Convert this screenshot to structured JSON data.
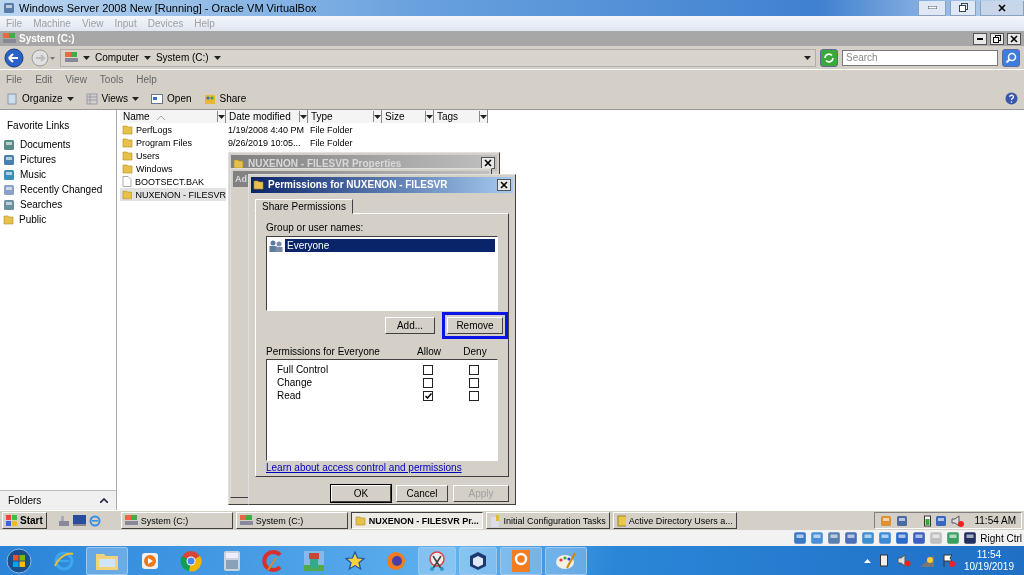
{
  "host_window": {
    "title": "Windows Server 2008 New [Running] - Oracle VM VirtualBox",
    "menu": [
      "File",
      "Machine",
      "View",
      "Input",
      "Devices",
      "Help"
    ]
  },
  "explorer": {
    "title": "System (C:)",
    "breadcrumb": [
      "Computer",
      "System (C:)"
    ],
    "search": {
      "placeholder": "Search"
    },
    "menu": [
      "File",
      "Edit",
      "View",
      "Tools",
      "Help"
    ],
    "toolbar": [
      {
        "label": "Organize",
        "kind": "dropdown"
      },
      {
        "label": "Views",
        "kind": "dropdown"
      },
      {
        "label": "Open",
        "kind": "open"
      },
      {
        "label": "Share",
        "kind": "share"
      }
    ],
    "sidebar": {
      "heading": "Favorite Links",
      "items": [
        {
          "label": "Documents"
        },
        {
          "label": "Pictures"
        },
        {
          "label": "Music"
        },
        {
          "label": "Recently Changed"
        },
        {
          "label": "Searches"
        },
        {
          "label": "Public",
          "kind": "folder"
        }
      ],
      "folders": "Folders"
    },
    "columns": [
      "Name",
      "Date modified",
      "Type",
      "Size",
      "Tags"
    ],
    "rows": [
      {
        "name": "PerfLogs",
        "date": "1/19/2008 4:40 PM",
        "type": "File Folder",
        "kind": "folder",
        "selected": false
      },
      {
        "name": "Program Files",
        "date": "9/26/2019 10:05...",
        "type": "File Folder",
        "kind": "folder",
        "selected": false
      },
      {
        "name": "Users",
        "kind": "folder",
        "selected": false
      },
      {
        "name": "Windows",
        "kind": "folder",
        "selected": false
      },
      {
        "name": "BOOTSECT.BAK",
        "kind": "file",
        "selected": false
      },
      {
        "name": "NUXENON - FILESVR",
        "kind": "folder",
        "selected": true
      }
    ]
  },
  "properties_dialog": {
    "title": "NUXENON - FILESVR Properties"
  },
  "advanced_dialog": {
    "title": "Ad"
  },
  "permissions_dialog": {
    "title": "Permissions for NUXENON - FILESVR",
    "tab": "Share Permissions",
    "group_label": "Group or user names:",
    "users": [
      {
        "name": "Everyone",
        "selected": true
      }
    ],
    "user_buttons": [
      {
        "label": "Add...",
        "highlighted": false
      },
      {
        "label": "Remove",
        "highlighted": true
      }
    ],
    "permissions_label": "Permissions for Everyone",
    "allow_label": "Allow",
    "deny_label": "Deny",
    "permissions": [
      {
        "name": "Full Control",
        "allow": false,
        "deny": false
      },
      {
        "name": "Change",
        "allow": false,
        "deny": false
      },
      {
        "name": "Read",
        "allow": true,
        "deny": false
      }
    ],
    "link": "Learn about access control and permissions",
    "buttons": [
      {
        "label": "OK",
        "disabled": false
      },
      {
        "label": "Cancel",
        "disabled": false
      },
      {
        "label": "Apply",
        "disabled": true
      }
    ]
  },
  "guest_taskbar": {
    "start": "Start",
    "tasks": [
      {
        "label": "System (C:)",
        "kind": "drive",
        "selected": false
      },
      {
        "label": "System (C:)",
        "kind": "drive",
        "selected": false
      },
      {
        "label": "NUXENON - FILESVR Pr...",
        "kind": "folder",
        "selected": true
      },
      {
        "label": "Initial Configuration Tasks",
        "kind": "tasks",
        "selected": false
      },
      {
        "label": "Active Directory Users a...",
        "kind": "book",
        "selected": false
      }
    ],
    "clock": "11:54 AM"
  },
  "vm_status": {
    "host_key": "Right Ctrl"
  },
  "host_taskbar": {
    "apps": [
      {
        "kind": "ie",
        "selected": false
      },
      {
        "kind": "explorer",
        "selected": true
      },
      {
        "kind": "media",
        "selected": false
      },
      {
        "kind": "chrome",
        "selected": false
      },
      {
        "kind": "calculator",
        "selected": false
      },
      {
        "kind": "cleaner",
        "selected": false
      },
      {
        "kind": "game",
        "selected": false
      },
      {
        "kind": "star",
        "selected": false
      },
      {
        "kind": "firefox",
        "selected": false
      },
      {
        "kind": "snip",
        "selected": true
      },
      {
        "kind": "vbox",
        "selected": true
      },
      {
        "kind": "pdf",
        "selected": true
      },
      {
        "kind": "paint",
        "selected": true
      }
    ],
    "time": "11:54",
    "date": "10/19/2019"
  }
}
